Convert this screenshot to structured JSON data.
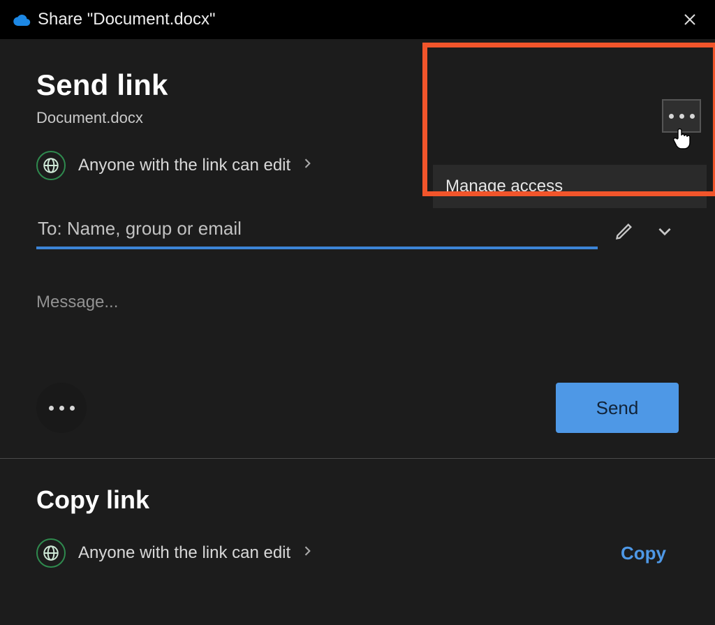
{
  "titlebar": {
    "text": "Share \"Document.docx\""
  },
  "sendlink": {
    "heading": "Send link",
    "filename": "Document.docx",
    "permission_text": "Anyone with the link can edit",
    "to_placeholder": "To: Name, group or email",
    "message_placeholder": "Message...",
    "send_label": "Send"
  },
  "menu": {
    "manage_access": "Manage access"
  },
  "copylink": {
    "heading": "Copy link",
    "permission_text": "Anyone with the link can edit",
    "copy_label": "Copy"
  }
}
